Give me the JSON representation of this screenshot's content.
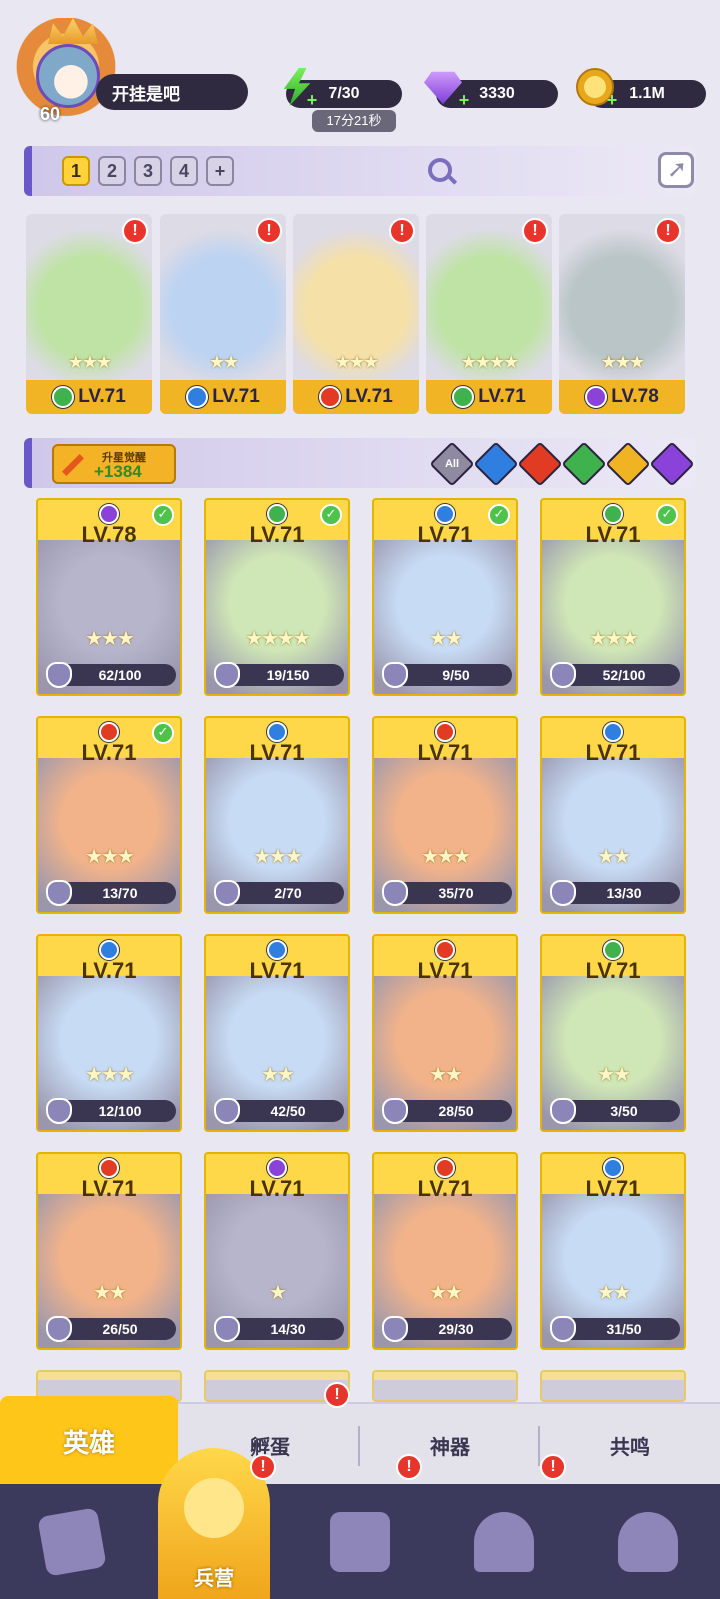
{
  "player": {
    "level": "60",
    "name": "开挂是吧"
  },
  "resources": {
    "energy": "7/30",
    "energy_timer": "17分21秒",
    "gems": "3330",
    "gold": "1.1M"
  },
  "team_tabs": [
    "1",
    "2",
    "3",
    "4",
    "+"
  ],
  "team": [
    {
      "level": "LV.71",
      "element": "green",
      "stars": "★★★",
      "alert": true
    },
    {
      "level": "LV.71",
      "element": "blue",
      "stars": "★★",
      "alert": true
    },
    {
      "level": "LV.71",
      "element": "red",
      "stars": "★★★",
      "alert": true
    },
    {
      "level": "LV.71",
      "element": "green",
      "stars": "★★★★",
      "alert": true
    },
    {
      "level": "LV.78",
      "element": "purple",
      "stars": "★★★",
      "alert": true
    }
  ],
  "awaken": {
    "label": "升星觉醒",
    "value": "+1384"
  },
  "filters": {
    "all": "All"
  },
  "heroes": [
    {
      "level": "LV.78",
      "element": "purple",
      "shards": "62/100",
      "stars": "★★★",
      "checked": true
    },
    {
      "level": "LV.71",
      "element": "green",
      "shards": "19/150",
      "stars": "★★★★",
      "checked": true
    },
    {
      "level": "LV.71",
      "element": "blue",
      "shards": "9/50",
      "stars": "★★",
      "checked": true
    },
    {
      "level": "LV.71",
      "element": "green",
      "shards": "52/100",
      "stars": "★★★",
      "checked": true
    },
    {
      "level": "LV.71",
      "element": "red",
      "shards": "13/70",
      "stars": "★★★",
      "checked": true
    },
    {
      "level": "LV.71",
      "element": "blue",
      "shards": "2/70",
      "stars": "★★★",
      "checked": false
    },
    {
      "level": "LV.71",
      "element": "red",
      "shards": "35/70",
      "stars": "★★★",
      "checked": false
    },
    {
      "level": "LV.71",
      "element": "blue",
      "shards": "13/30",
      "stars": "★★",
      "checked": false
    },
    {
      "level": "LV.71",
      "element": "blue",
      "shards": "12/100",
      "stars": "★★★",
      "checked": false
    },
    {
      "level": "LV.71",
      "element": "blue",
      "shards": "42/50",
      "stars": "★★",
      "checked": false
    },
    {
      "level": "LV.71",
      "element": "red",
      "shards": "28/50",
      "stars": "★★",
      "checked": false
    },
    {
      "level": "LV.71",
      "element": "green",
      "shards": "3/50",
      "stars": "★★",
      "checked": false
    },
    {
      "level": "LV.71",
      "element": "red",
      "shards": "26/50",
      "stars": "★★",
      "checked": false
    },
    {
      "level": "LV.71",
      "element": "purple",
      "shards": "14/30",
      "stars": "★",
      "checked": false
    },
    {
      "level": "LV.71",
      "element": "red",
      "shards": "29/30",
      "stars": "★★",
      "checked": false
    },
    {
      "level": "LV.71",
      "element": "blue",
      "shards": "31/50",
      "stars": "★★",
      "checked": false
    }
  ],
  "subtabs": [
    "英雄",
    "孵蛋",
    "神器",
    "共鸣"
  ],
  "bottom_nav": {
    "active_label": "兵营"
  },
  "colors": {
    "accent": "#ffc61a",
    "nav_bg": "#3c3a5c",
    "alert": "#e8352b"
  }
}
